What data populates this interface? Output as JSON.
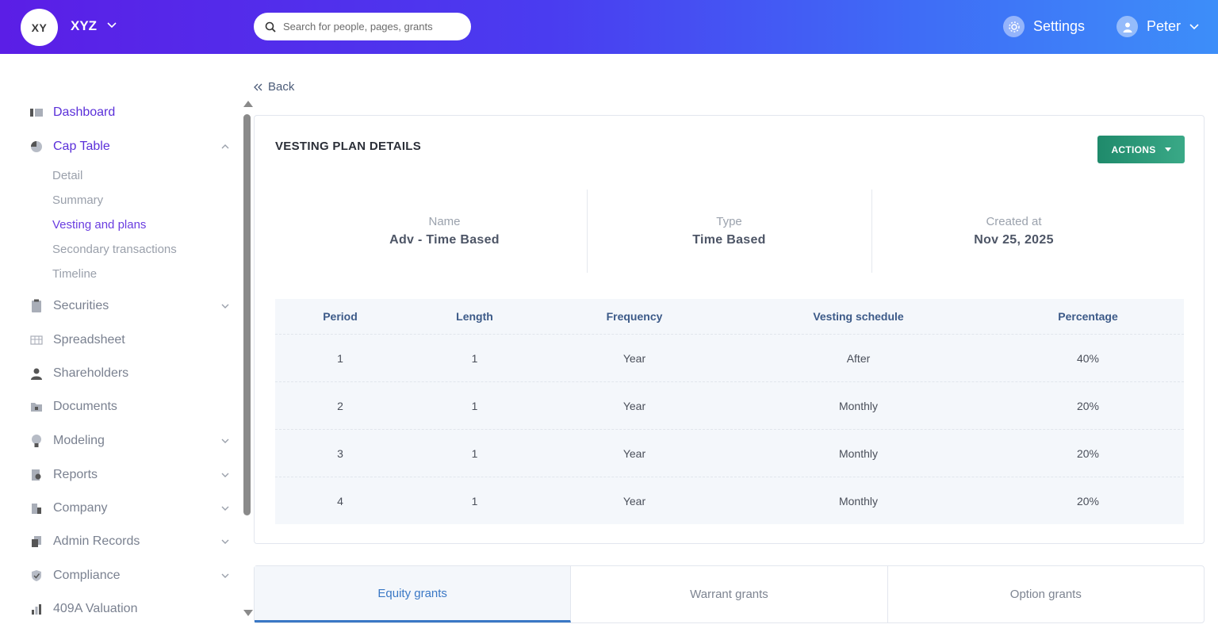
{
  "header": {
    "logo_text": "XY",
    "company_name": "XYZ",
    "search_placeholder": "Search for people, pages, grants",
    "settings_label": "Settings",
    "user_name": "Peter",
    "gradient_start": "#5b1ee6",
    "gradient_end": "#3d8ef9"
  },
  "sidebar": {
    "items": [
      {
        "label": "Dashboard",
        "icon": "dashboard-icon"
      },
      {
        "label": "Cap Table",
        "icon": "pie-chart-icon"
      },
      {
        "label": "Securities",
        "icon": "clipboard-icon"
      },
      {
        "label": "Spreadsheet",
        "icon": "grid-icon"
      },
      {
        "label": "Shareholders",
        "icon": "person-icon"
      },
      {
        "label": "Documents",
        "icon": "folder-icon"
      },
      {
        "label": "Modeling",
        "icon": "lightbulb-icon"
      },
      {
        "label": "Reports",
        "icon": "report-icon"
      },
      {
        "label": "Company",
        "icon": "building-icon"
      },
      {
        "label": "Admin Records",
        "icon": "records-icon"
      },
      {
        "label": "Compliance",
        "icon": "shield-icon"
      },
      {
        "label": "409A Valuation",
        "icon": "bar-chart-icon"
      }
    ],
    "cap_table_sub": [
      "Detail",
      "Summary",
      "Vesting and plans",
      "Secondary transactions",
      "Timeline"
    ]
  },
  "main": {
    "back_label": "Back",
    "card_title": "VESTING PLAN DETAILS",
    "actions_label": "ACTIONS",
    "info": [
      {
        "key": "Name",
        "value": "Adv - Time Based"
      },
      {
        "key": "Type",
        "value": "Time Based"
      },
      {
        "key": "Created at",
        "value": "Nov 25, 2025"
      }
    ],
    "table": {
      "headers": [
        "Period",
        "Length",
        "Frequency",
        "Vesting schedule",
        "Percentage"
      ],
      "rows": [
        [
          "1",
          "1",
          "Year",
          "After",
          "40%"
        ],
        [
          "2",
          "1",
          "Year",
          "Monthly",
          "20%"
        ],
        [
          "3",
          "1",
          "Year",
          "Monthly",
          "20%"
        ],
        [
          "4",
          "1",
          "Year",
          "Monthly",
          "20%"
        ]
      ]
    },
    "tabs": [
      "Equity grants",
      "Warrant grants",
      "Option grants"
    ]
  },
  "colors": {
    "accent_purple": "#5a2fd9",
    "actions_green": "#1f8a6b",
    "tab_active_blue": "#3a78c5"
  }
}
